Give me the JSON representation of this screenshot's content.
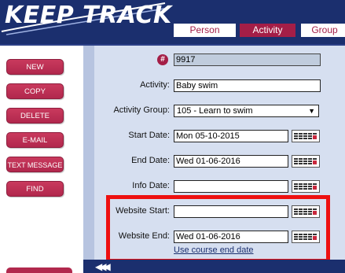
{
  "app": {
    "logo_text": "KEEP TRACK"
  },
  "header": {
    "tabs": [
      {
        "label": "Person",
        "active": false
      },
      {
        "label": "Activity",
        "active": true
      },
      {
        "label": "Group",
        "active": false
      }
    ]
  },
  "sidebar": {
    "buttons": [
      "NEW",
      "COPY",
      "DELETE",
      "E-MAIL",
      "TEXT MESSAGE",
      "FIND"
    ]
  },
  "form": {
    "id_field": {
      "value": "9917"
    },
    "activity": {
      "label": "Activity:",
      "value": "Baby swim"
    },
    "activity_group": {
      "label": "Activity Group:",
      "value": "105 - Learn to swim"
    },
    "start_date": {
      "label": "Start Date:",
      "value": "Mon 05-10-2015"
    },
    "end_date": {
      "label": "End Date:",
      "value": "Wed 01-06-2016"
    },
    "info_date": {
      "label": "Info Date:",
      "value": ""
    },
    "website_start": {
      "label": "Website Start:",
      "value": ""
    },
    "website_end": {
      "label": "Website End:",
      "value": "Wed 01-06-2016"
    },
    "use_course_end_date": "Use course end date"
  },
  "colors": {
    "brand_navy": "#1b2f6e",
    "accent_crimson": "#a41e47",
    "highlight_red": "#ee1010"
  }
}
